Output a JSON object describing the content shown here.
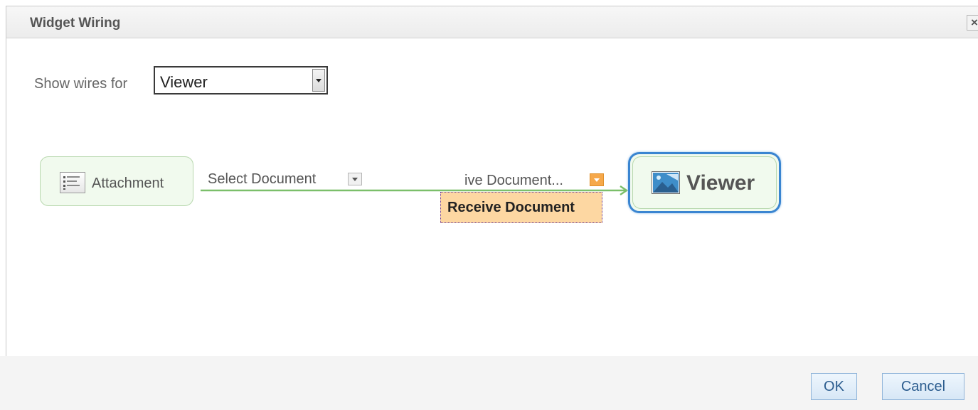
{
  "dialog": {
    "title": "Widget Wiring",
    "close_label": "×"
  },
  "filter": {
    "label": "Show wires for",
    "selected": "Viewer"
  },
  "source_widget": {
    "name": "Attachment",
    "icon": "list-document-icon",
    "event_label": "Select Document"
  },
  "target_widget": {
    "name": "Viewer",
    "icon": "image-viewer-icon",
    "handler_label": "ive Document...",
    "tooltip": "Receive Document"
  },
  "buttons": {
    "ok": "OK",
    "cancel": "Cancel"
  },
  "colors": {
    "wire": "#7bbf6a",
    "viewer_border": "#3a85d1",
    "tooltip_bg": "#fdd7a2",
    "button_text": "#2c5d8f"
  }
}
